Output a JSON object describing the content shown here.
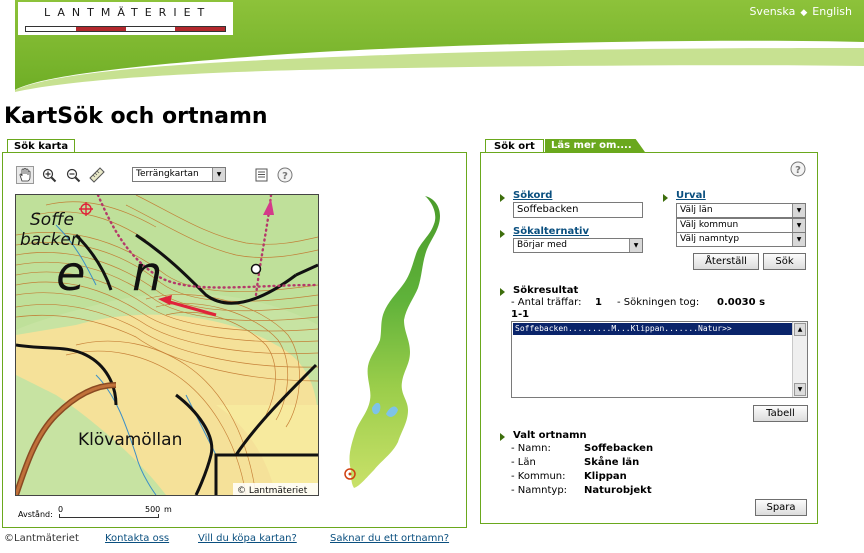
{
  "header": {
    "logo_text": "LANTMÄTERIET",
    "lang_svenska": "Svenska",
    "lang_sep": "◆",
    "lang_english": "English",
    "colors": {
      "green": "#7ab530",
      "light_green": "#c6e08d",
      "red": "#b3282d"
    }
  },
  "page_title": "KartSök och ortnamn",
  "map_panel": {
    "tab_label": "Sök karta",
    "map_type_selected": "Terrängkartan",
    "map_labels": {
      "place_1_line1": "Soffe",
      "place_1_line2": "backen",
      "big_letter_1": "e",
      "big_letter_2": "n",
      "place_2": "Klövamöllan",
      "copyright": "© Lantmäteriet"
    },
    "scale": {
      "label": "Avstånd:",
      "start": "0",
      "end": "500",
      "unit": "m"
    }
  },
  "search_panel": {
    "tab_active": "Sök ort",
    "tab_inactive": "Läs mer om....",
    "sokord_label": "Sökord",
    "sokord_value": "Soffebacken",
    "sokalternativ_label": "Sökalternativ",
    "sokalternativ_value": "Börjar med",
    "urval_label": "Urval",
    "urval_lan": "Välj län",
    "urval_kommun": "Välj kommun",
    "urval_namntyp": "Välj namntyp",
    "reset_button": "Återställ",
    "search_button": "Sök",
    "results_heading": "Sökresultat",
    "hits_label": "- Antal träffar:",
    "hits_value": "1",
    "time_label": "- Sökningen tog:",
    "time_value": "0.0030 s",
    "range": "1-1",
    "result_rows": [
      "Soffebacken.........M...Klippan.......Natur>>"
    ],
    "table_button": "Tabell",
    "selected_heading": "Valt ortnamn",
    "selected": [
      {
        "label": "- Namn:",
        "value": "Soffebacken"
      },
      {
        "label": "- Län",
        "value": "Skåne län"
      },
      {
        "label": "- Kommun:",
        "value": "Klippan"
      },
      {
        "label": "- Namntyp:",
        "value": "Naturobjekt"
      }
    ],
    "save_button": "Spara"
  },
  "footer": {
    "copyright": "©Lantmäteriet",
    "link_contact": "Kontakta oss",
    "link_buy": "Vill du köpa kartan?",
    "link_missing": "Saknar du ett ortnamn?"
  }
}
